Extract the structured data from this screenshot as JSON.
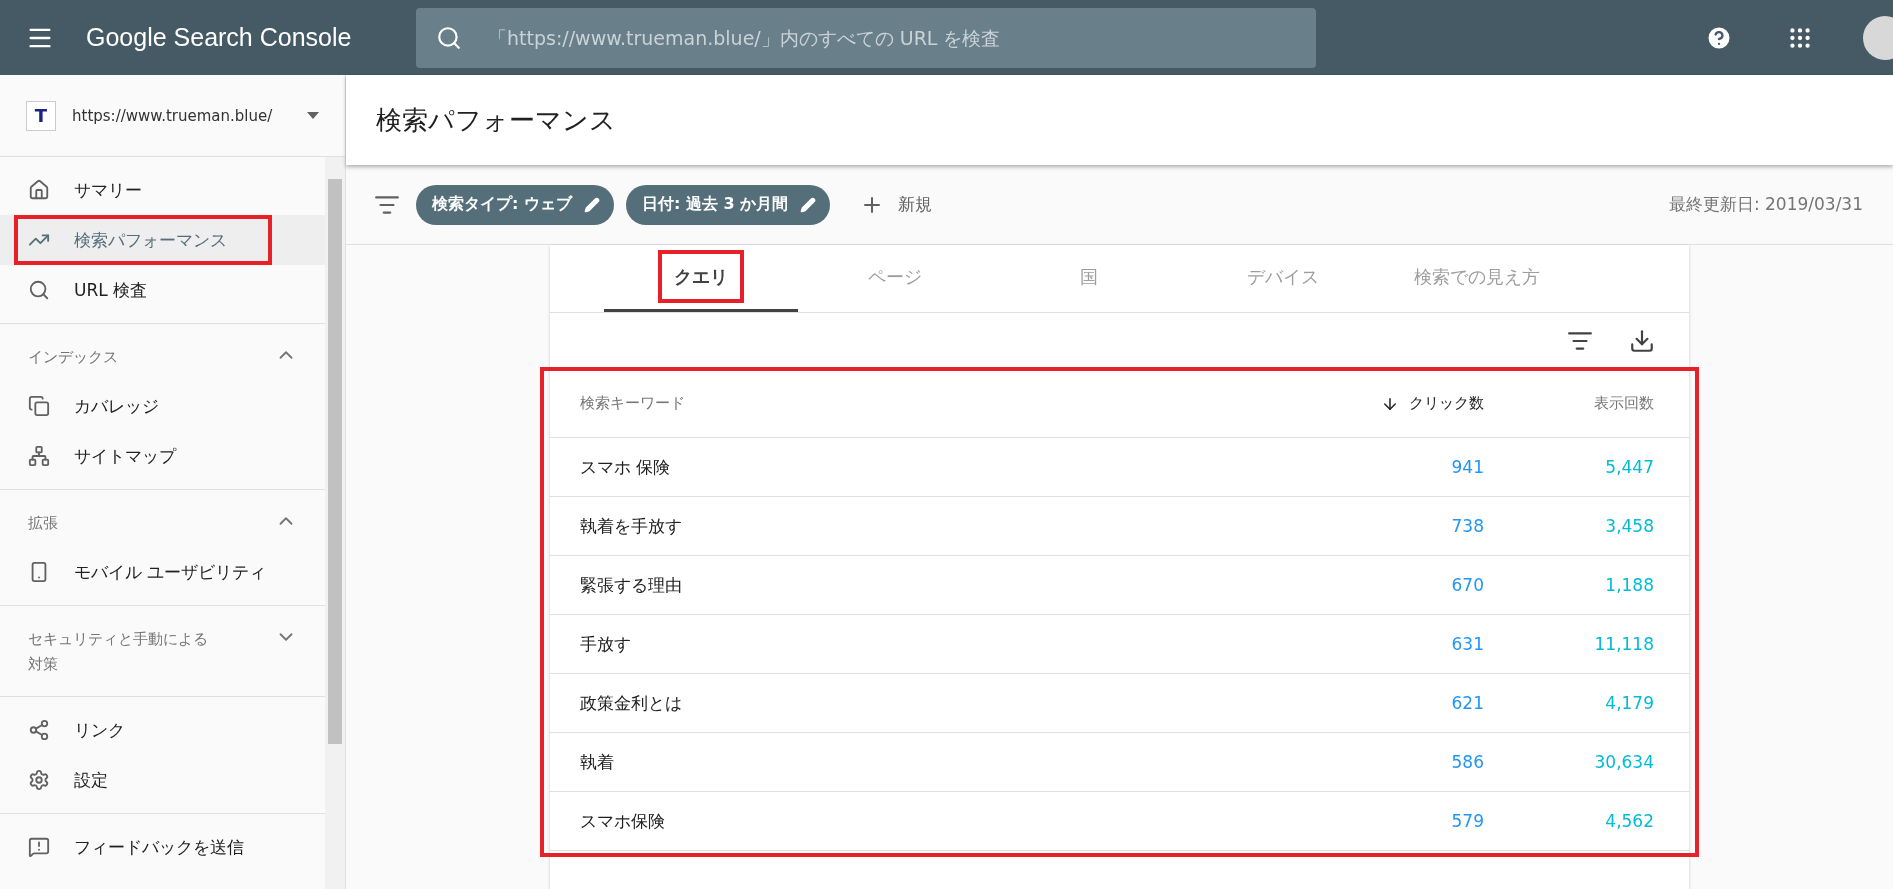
{
  "topbar": {
    "product": "Google Search Console",
    "search": {
      "placeholder": "「https://www.trueman.blue/」内のすべての URL を検査"
    }
  },
  "property": {
    "badge": "T",
    "url": "https://www.trueman.blue/"
  },
  "sidebar": {
    "sections": [
      {
        "items": [
          {
            "label": "サマリー",
            "selected": false,
            "highlighted": false
          },
          {
            "label": "検索パフォーマンス",
            "selected": true,
            "highlighted": true
          },
          {
            "label": "URL 検査",
            "selected": false,
            "highlighted": false
          }
        ]
      },
      {
        "title": "インデックス",
        "expanded": true,
        "items": [
          {
            "label": "カバレッジ",
            "selected": false,
            "highlighted": false
          },
          {
            "label": "サイトマップ",
            "selected": false,
            "highlighted": false
          }
        ]
      },
      {
        "title": "拡張",
        "expanded": true,
        "items": [
          {
            "label": "モバイル ユーザビリティ",
            "selected": false,
            "highlighted": false
          }
        ]
      },
      {
        "title": "セキュリティと手動による対策",
        "expanded": false
      },
      {
        "items": [
          {
            "label": "リンク",
            "selected": false,
            "highlighted": false
          },
          {
            "label": "設定",
            "selected": false,
            "highlighted": false
          }
        ]
      },
      {
        "items": [
          {
            "label": "フィードバックを送信",
            "selected": false,
            "highlighted": false
          }
        ]
      }
    ]
  },
  "page_title": "検索パフォーマンス",
  "filters": {
    "chips": [
      "検索タイプ: ウェブ",
      "日付: 過去 3 か月間"
    ],
    "new": "新規",
    "updated": "最終更新日: 2019/03/31"
  },
  "tabs": [
    {
      "label": "クエリ",
      "selected": true,
      "highlighted": true
    },
    {
      "label": "ページ",
      "selected": false,
      "highlighted": false
    },
    {
      "label": "国",
      "selected": false,
      "highlighted": false
    },
    {
      "label": "デバイス",
      "selected": false,
      "highlighted": false
    },
    {
      "label": "検索での見え方",
      "selected": false,
      "highlighted": false
    }
  ],
  "table": {
    "highlighted": true,
    "columns": [
      {
        "label": "検索キーワード",
        "sorted": false
      },
      {
        "label": "クリック数",
        "sorted": true
      },
      {
        "label": "表示回数",
        "sorted": false
      }
    ],
    "rows": [
      {
        "keyword": "スマホ 保険",
        "clicks": "941",
        "impressions": "5,447"
      },
      {
        "keyword": "執着を手放す",
        "clicks": "738",
        "impressions": "3,458"
      },
      {
        "keyword": "緊張する理由",
        "clicks": "670",
        "impressions": "1,188"
      },
      {
        "keyword": "手放す",
        "clicks": "631",
        "impressions": "11,118"
      },
      {
        "keyword": "政策金利とは",
        "clicks": "621",
        "impressions": "4,179"
      },
      {
        "keyword": "執着",
        "clicks": "586",
        "impressions": "30,634"
      },
      {
        "keyword": "スマホ保険",
        "clicks": "579",
        "impressions": "4,562"
      }
    ]
  }
}
